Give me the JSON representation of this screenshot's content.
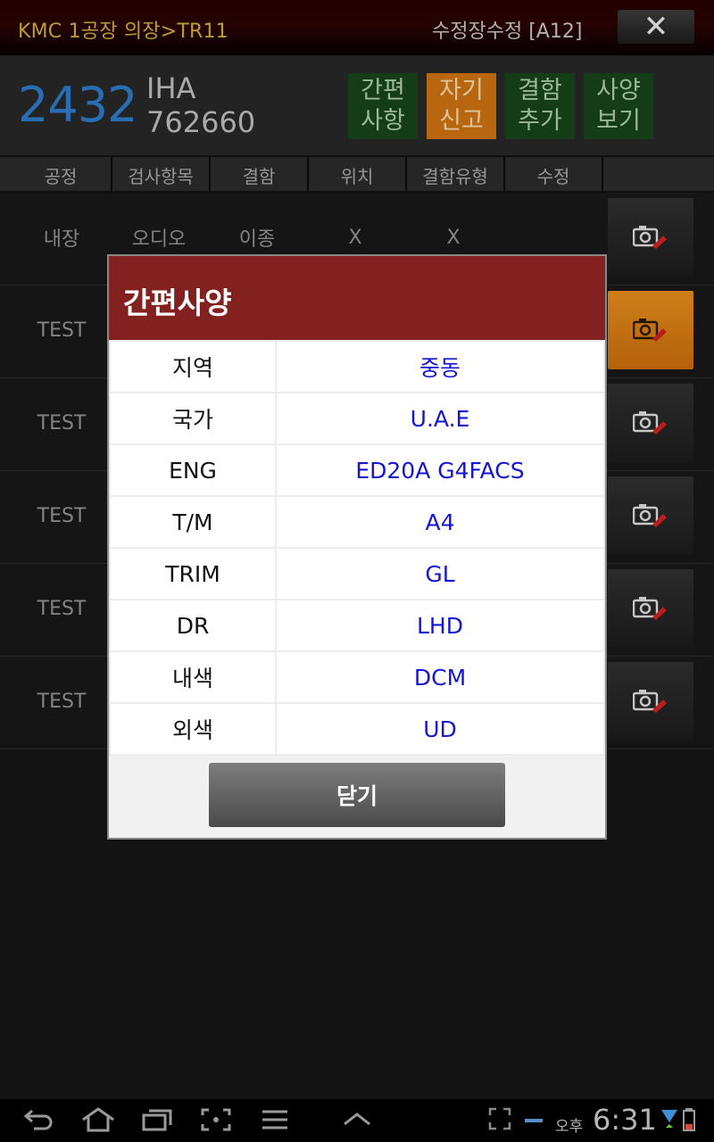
{
  "titlebar": {
    "location": "KMC 1공장 의장>TR11",
    "screen": "수정장수정 [A12]",
    "close_glyph": "✕"
  },
  "vehicle": {
    "number": "2432",
    "code": "IHA",
    "vin": "762660"
  },
  "header_buttons": [
    {
      "label": "간편\n사항",
      "style": "green"
    },
    {
      "label": "자기\n신고",
      "style": "orange"
    },
    {
      "label": "결함\n추가",
      "style": "green"
    },
    {
      "label": "사양\n보기",
      "style": "green"
    }
  ],
  "columns": [
    "공정",
    "검사항목",
    "결함",
    "위치",
    "결함유형",
    "수정"
  ],
  "rows": [
    {
      "process": "내장",
      "item": "오디오",
      "defect": "이종",
      "position": "X",
      "type": "X"
    },
    {
      "process": "TEST"
    },
    {
      "process": "TEST"
    },
    {
      "process": "TEST"
    },
    {
      "process": "TEST"
    },
    {
      "process": "TEST"
    }
  ],
  "modal": {
    "title": "간편사양",
    "specs": [
      {
        "key": "지역",
        "value": "중동"
      },
      {
        "key": "국가",
        "value": "U.A.E"
      },
      {
        "key": "ENG",
        "value": "ED20A G4FACS"
      },
      {
        "key": "T/M",
        "value": "A4"
      },
      {
        "key": "TRIM",
        "value": "GL"
      },
      {
        "key": "DR",
        "value": "LHD"
      },
      {
        "key": "내색",
        "value": "DCM"
      },
      {
        "key": "외색",
        "value": "UD"
      }
    ],
    "close_label": "닫기"
  },
  "status": {
    "ampm": "오후",
    "time": "6:31"
  },
  "colors": {
    "accent_red": "#832121",
    "vehicle_number": "#2d78c2",
    "spec_value": "#1515d8",
    "active_orange": "#c96f12"
  }
}
